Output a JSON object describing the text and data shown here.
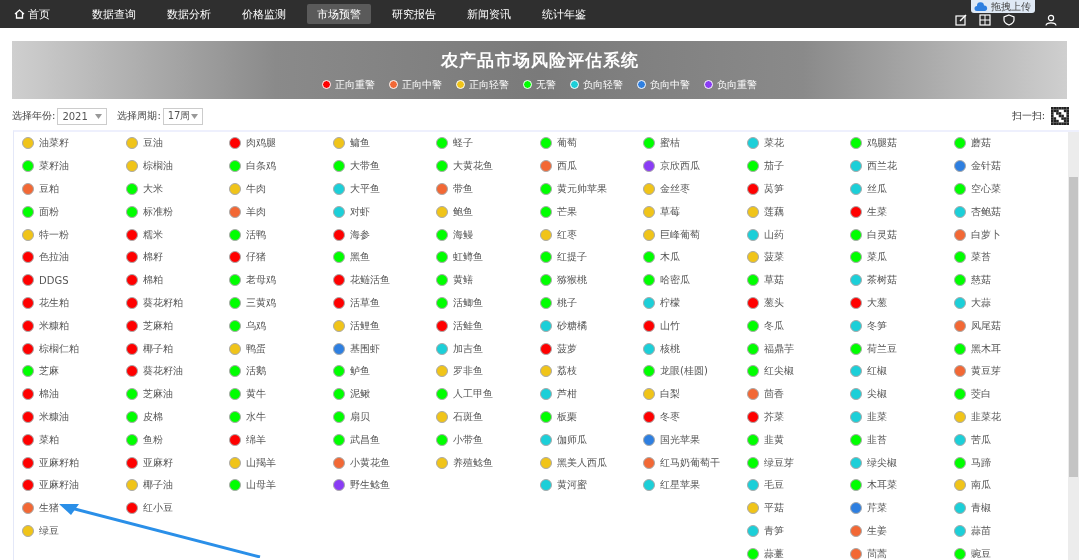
{
  "nav": {
    "items": [
      {
        "label": "首页",
        "kind": "home",
        "selected": false
      },
      {
        "label": "数据查询",
        "kind": "text",
        "selected": false
      },
      {
        "label": "数据分析",
        "kind": "text",
        "selected": false
      },
      {
        "label": "价格监测",
        "kind": "text",
        "selected": false
      },
      {
        "label": "市场预警",
        "kind": "text",
        "selected": true
      },
      {
        "label": "研究报告",
        "kind": "text",
        "selected": false
      },
      {
        "label": "新闻资讯",
        "kind": "text",
        "selected": false
      },
      {
        "label": "统计年鉴",
        "kind": "text",
        "selected": false
      }
    ],
    "upload_badge": "拖拽上传"
  },
  "banner": {
    "title": "农产品市场风险评估系统",
    "legend": [
      {
        "label": "正向重警",
        "color": "#ff0000"
      },
      {
        "label": "正向中警",
        "color": "#f26835"
      },
      {
        "label": "正向轻警",
        "color": "#f0c419"
      },
      {
        "label": "无警",
        "color": "#00ff00"
      },
      {
        "label": "负向轻警",
        "color": "#1ccfd8"
      },
      {
        "label": "负向中警",
        "color": "#2e7fe0"
      },
      {
        "label": "负向重警",
        "color": "#8a3cf5"
      }
    ]
  },
  "filters": {
    "year_label": "选择年份:",
    "year": "2021",
    "period_label": "选择周期:",
    "period": "17周",
    "scan_label": "扫一扫:"
  },
  "indicator_columns": [
    [
      {
        "name": "油菜籽",
        "color": "#f0c419"
      },
      {
        "name": "菜籽油",
        "color": "#00ff00"
      },
      {
        "name": "豆粕",
        "color": "#f26835"
      },
      {
        "name": "面粉",
        "color": "#00ff00"
      },
      {
        "name": "特一粉",
        "color": "#f0c419"
      },
      {
        "name": "色拉油",
        "color": "#ff0000"
      },
      {
        "name": "DDGS",
        "color": "#ff0000"
      },
      {
        "name": "花生粕",
        "color": "#ff0000"
      },
      {
        "name": "米糠粕",
        "color": "#ff0000"
      },
      {
        "name": "棕榈仁粕",
        "color": "#ff0000"
      },
      {
        "name": "芝麻",
        "color": "#00ff00"
      },
      {
        "name": "棉油",
        "color": "#ff0000"
      },
      {
        "name": "米糠油",
        "color": "#ff0000"
      },
      {
        "name": "菜粕",
        "color": "#ff0000"
      },
      {
        "name": "亚麻籽粕",
        "color": "#ff0000"
      },
      {
        "name": "亚麻籽油",
        "color": "#ff0000"
      },
      {
        "name": "生猪",
        "color": "#f26835"
      },
      {
        "name": "绿豆",
        "color": "#f0c419"
      }
    ],
    [
      {
        "name": "豆油",
        "color": "#f0c419"
      },
      {
        "name": "棕榈油",
        "color": "#f0c419"
      },
      {
        "name": "大米",
        "color": "#00ff00"
      },
      {
        "name": "标准粉",
        "color": "#00ff00"
      },
      {
        "name": "糯米",
        "color": "#ff0000"
      },
      {
        "name": "棉籽",
        "color": "#ff0000"
      },
      {
        "name": "棉粕",
        "color": "#ff0000"
      },
      {
        "name": "葵花籽粕",
        "color": "#ff0000"
      },
      {
        "name": "芝麻粕",
        "color": "#ff0000"
      },
      {
        "name": "椰子粕",
        "color": "#ff0000"
      },
      {
        "name": "葵花籽油",
        "color": "#ff0000"
      },
      {
        "name": "芝麻油",
        "color": "#00ff00"
      },
      {
        "name": "皮棉",
        "color": "#00ff00"
      },
      {
        "name": "鱼粉",
        "color": "#00ff00"
      },
      {
        "name": "亚麻籽",
        "color": "#ff0000"
      },
      {
        "name": "椰子油",
        "color": "#f0c419"
      },
      {
        "name": "红小豆",
        "color": "#ff0000"
      }
    ],
    [
      {
        "name": "肉鸡腿",
        "color": "#ff0000"
      },
      {
        "name": "白条鸡",
        "color": "#00ff00"
      },
      {
        "name": "牛肉",
        "color": "#f0c419"
      },
      {
        "name": "羊肉",
        "color": "#f26835"
      },
      {
        "name": "活鸭",
        "color": "#00ff00"
      },
      {
        "name": "仔猪",
        "color": "#ff0000"
      },
      {
        "name": "老母鸡",
        "color": "#00ff00"
      },
      {
        "name": "三黄鸡",
        "color": "#00ff00"
      },
      {
        "name": "乌鸡",
        "color": "#00ff00"
      },
      {
        "name": "鸭蛋",
        "color": "#f0c419"
      },
      {
        "name": "活鹅",
        "color": "#00ff00"
      },
      {
        "name": "黄牛",
        "color": "#00ff00"
      },
      {
        "name": "水牛",
        "color": "#00ff00"
      },
      {
        "name": "绵羊",
        "color": "#ff0000"
      },
      {
        "name": "山羯羊",
        "color": "#f0c419"
      },
      {
        "name": "山母羊",
        "color": "#00ff00"
      }
    ],
    [
      {
        "name": "鳙鱼",
        "color": "#f0c419"
      },
      {
        "name": "大带鱼",
        "color": "#00ff00"
      },
      {
        "name": "大平鱼",
        "color": "#1ccfd8"
      },
      {
        "name": "对虾",
        "color": "#1ccfd8"
      },
      {
        "name": "海参",
        "color": "#ff0000"
      },
      {
        "name": "黑鱼",
        "color": "#00ff00"
      },
      {
        "name": "花鲢活鱼",
        "color": "#ff0000"
      },
      {
        "name": "活草鱼",
        "color": "#ff0000"
      },
      {
        "name": "活鲤鱼",
        "color": "#f0c419"
      },
      {
        "name": "基围虾",
        "color": "#2e7fe0"
      },
      {
        "name": "鲈鱼",
        "color": "#00ff00"
      },
      {
        "name": "泥鳅",
        "color": "#00ff00"
      },
      {
        "name": "扇贝",
        "color": "#00ff00"
      },
      {
        "name": "武昌鱼",
        "color": "#00ff00"
      },
      {
        "name": "小黄花鱼",
        "color": "#f26835"
      },
      {
        "name": "野生鲶鱼",
        "color": "#8a3cf5"
      }
    ],
    [
      {
        "name": "蛏子",
        "color": "#00ff00"
      },
      {
        "name": "大黄花鱼",
        "color": "#00ff00"
      },
      {
        "name": "带鱼",
        "color": "#f26835"
      },
      {
        "name": "鲍鱼",
        "color": "#f0c419"
      },
      {
        "name": "海鳗",
        "color": "#00ff00"
      },
      {
        "name": "虹鳟鱼",
        "color": "#00ff00"
      },
      {
        "name": "黄鳝",
        "color": "#00ff00"
      },
      {
        "name": "活鲫鱼",
        "color": "#00ff00"
      },
      {
        "name": "活鲑鱼",
        "color": "#ff0000"
      },
      {
        "name": "加吉鱼",
        "color": "#1ccfd8"
      },
      {
        "name": "罗非鱼",
        "color": "#f0c419"
      },
      {
        "name": "人工甲鱼",
        "color": "#00ff00"
      },
      {
        "name": "石斑鱼",
        "color": "#f0c419"
      },
      {
        "name": "小带鱼",
        "color": "#00ff00"
      },
      {
        "name": "养殖鲶鱼",
        "color": "#f0c419"
      }
    ],
    [
      {
        "name": "葡萄",
        "color": "#00ff00"
      },
      {
        "name": "西瓜",
        "color": "#f26835"
      },
      {
        "name": "黄元帅苹果",
        "color": "#00ff00"
      },
      {
        "name": "芒果",
        "color": "#00ff00"
      },
      {
        "name": "红枣",
        "color": "#f0c419"
      },
      {
        "name": "红提子",
        "color": "#00ff00"
      },
      {
        "name": "猕猴桃",
        "color": "#00ff00"
      },
      {
        "name": "桃子",
        "color": "#00ff00"
      },
      {
        "name": "砂糖橘",
        "color": "#1ccfd8"
      },
      {
        "name": "菠萝",
        "color": "#ff0000"
      },
      {
        "name": "荔枝",
        "color": "#f0c419"
      },
      {
        "name": "芦柑",
        "color": "#1ccfd8"
      },
      {
        "name": "板栗",
        "color": "#00ff00"
      },
      {
        "name": "伽师瓜",
        "color": "#1ccfd8"
      },
      {
        "name": "黑美人西瓜",
        "color": "#f0c419"
      },
      {
        "name": "黄河蜜",
        "color": "#1ccfd8"
      }
    ],
    [
      {
        "name": "蜜桔",
        "color": "#00ff00"
      },
      {
        "name": "京欣西瓜",
        "color": "#8a3cf5"
      },
      {
        "name": "金丝枣",
        "color": "#f0c419"
      },
      {
        "name": "草莓",
        "color": "#f0c419"
      },
      {
        "name": "巨峰葡萄",
        "color": "#f0c419"
      },
      {
        "name": "木瓜",
        "color": "#00ff00"
      },
      {
        "name": "哈密瓜",
        "color": "#00ff00"
      },
      {
        "name": "柠檬",
        "color": "#1ccfd8"
      },
      {
        "name": "山竹",
        "color": "#ff0000"
      },
      {
        "name": "核桃",
        "color": "#1ccfd8"
      },
      {
        "name": "龙眼(桂圆)",
        "color": "#00ff00"
      },
      {
        "name": "白梨",
        "color": "#f0c419"
      },
      {
        "name": "冬枣",
        "color": "#ff0000"
      },
      {
        "name": "国光苹果",
        "color": "#2e7fe0"
      },
      {
        "name": "红马奶葡萄干",
        "color": "#f26835"
      },
      {
        "name": "红星苹果",
        "color": "#1ccfd8"
      }
    ],
    [
      {
        "name": "菜花",
        "color": "#1ccfd8"
      },
      {
        "name": "茄子",
        "color": "#00ff00"
      },
      {
        "name": "莴笋",
        "color": "#ff0000"
      },
      {
        "name": "莲藕",
        "color": "#f0c419"
      },
      {
        "name": "山药",
        "color": "#1ccfd8"
      },
      {
        "name": "菠菜",
        "color": "#f0c419"
      },
      {
        "name": "草菇",
        "color": "#00ff00"
      },
      {
        "name": "葱头",
        "color": "#ff0000"
      },
      {
        "name": "冬瓜",
        "color": "#00ff00"
      },
      {
        "name": "福鼎芋",
        "color": "#00ff00"
      },
      {
        "name": "红尖椒",
        "color": "#00ff00"
      },
      {
        "name": "茴香",
        "color": "#f26835"
      },
      {
        "name": "芥菜",
        "color": "#ff0000"
      },
      {
        "name": "韭黄",
        "color": "#00ff00"
      },
      {
        "name": "绿豆芽",
        "color": "#00ff00"
      },
      {
        "name": "毛豆",
        "color": "#1ccfd8"
      },
      {
        "name": "平菇",
        "color": "#f0c419"
      },
      {
        "name": "青笋",
        "color": "#1ccfd8"
      },
      {
        "name": "蒜薹",
        "color": "#00ff00"
      }
    ],
    [
      {
        "name": "鸡腿菇",
        "color": "#00ff00"
      },
      {
        "name": "西兰花",
        "color": "#1ccfd8"
      },
      {
        "name": "丝瓜",
        "color": "#1ccfd8"
      },
      {
        "name": "生菜",
        "color": "#ff0000"
      },
      {
        "name": "白灵菇",
        "color": "#00ff00"
      },
      {
        "name": "菜瓜",
        "color": "#00ff00"
      },
      {
        "name": "茶树菇",
        "color": "#1ccfd8"
      },
      {
        "name": "大葱",
        "color": "#ff0000"
      },
      {
        "name": "冬笋",
        "color": "#1ccfd8"
      },
      {
        "name": "荷兰豆",
        "color": "#00ff00"
      },
      {
        "name": "红椒",
        "color": "#1ccfd8"
      },
      {
        "name": "尖椒",
        "color": "#1ccfd8"
      },
      {
        "name": "韭菜",
        "color": "#1ccfd8"
      },
      {
        "name": "韭苔",
        "color": "#00ff00"
      },
      {
        "name": "绿尖椒",
        "color": "#1ccfd8"
      },
      {
        "name": "木耳菜",
        "color": "#00ff00"
      },
      {
        "name": "芹菜",
        "color": "#2e7fe0"
      },
      {
        "name": "生姜",
        "color": "#f26835"
      },
      {
        "name": "茼蒿",
        "color": "#f26835"
      }
    ],
    [
      {
        "name": "蘑菇",
        "color": "#00ff00"
      },
      {
        "name": "金针菇",
        "color": "#2e7fe0"
      },
      {
        "name": "空心菜",
        "color": "#00ff00"
      },
      {
        "name": "杏鲍菇",
        "color": "#1ccfd8"
      },
      {
        "name": "白萝卜",
        "color": "#f26835"
      },
      {
        "name": "菜苔",
        "color": "#00ff00"
      },
      {
        "name": "慈菇",
        "color": "#00ff00"
      },
      {
        "name": "大蒜",
        "color": "#1ccfd8"
      },
      {
        "name": "凤尾菇",
        "color": "#f26835"
      },
      {
        "name": "黑木耳",
        "color": "#00ff00"
      },
      {
        "name": "黄豆芽",
        "color": "#f26835"
      },
      {
        "name": "茭白",
        "color": "#00ff00"
      },
      {
        "name": "韭菜花",
        "color": "#f0c419"
      },
      {
        "name": "苦瓜",
        "color": "#1ccfd8"
      },
      {
        "name": "马蹄",
        "color": "#00ff00"
      },
      {
        "name": "南瓜",
        "color": "#f0c419"
      },
      {
        "name": "青椒",
        "color": "#1ccfd8"
      },
      {
        "name": "蒜苗",
        "color": "#1ccfd8"
      },
      {
        "name": "豌豆",
        "color": "#00ff00"
      }
    ]
  ]
}
